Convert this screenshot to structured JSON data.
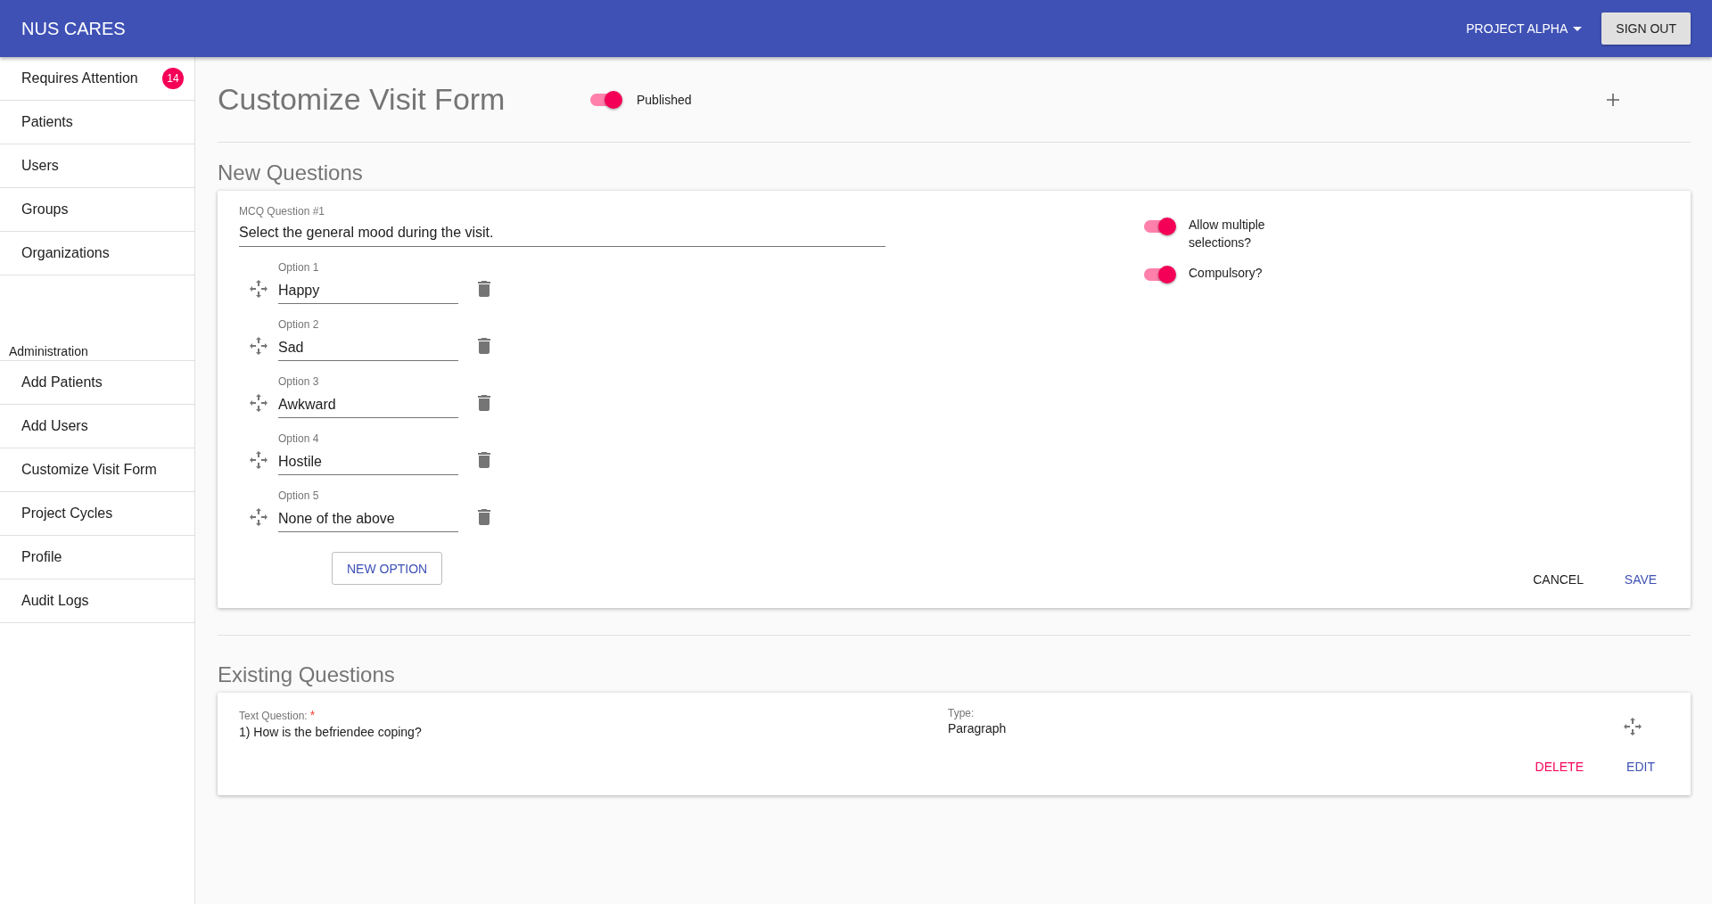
{
  "app_bar": {
    "title": "NUS CARES",
    "project_menu": "PROJECT ALPHA",
    "sign_out": "SIGN OUT"
  },
  "sidebar": {
    "items": [
      {
        "label": "Requires Attention",
        "badge": "14",
        "selected": false
      },
      {
        "label": "Patients",
        "selected": false
      },
      {
        "label": "Users",
        "selected": false
      },
      {
        "label": "Groups",
        "selected": false
      },
      {
        "label": "Organizations",
        "selected": false
      }
    ],
    "section_title": "Administration",
    "admin_items": [
      {
        "label": "Add Patients",
        "selected": false
      },
      {
        "label": "Add Users",
        "selected": false
      },
      {
        "label": "Customize Visit Form",
        "selected": false
      },
      {
        "label": "Project Cycles",
        "selected": false
      },
      {
        "label": "Profile",
        "selected": false
      },
      {
        "label": "Audit Logs",
        "selected": false
      }
    ]
  },
  "page": {
    "title": "Customize Visit Form",
    "published": {
      "label": "Published",
      "on": true
    }
  },
  "new_questions": {
    "heading": "New Questions",
    "question": {
      "label": "MCQ Question #1",
      "value": "Select the general mood during the visit.",
      "options": [
        {
          "label": "Option 1",
          "value": "Happy"
        },
        {
          "label": "Option 2",
          "value": "Sad"
        },
        {
          "label": "Option 3",
          "value": "Awkward"
        },
        {
          "label": "Option 4",
          "value": "Hostile"
        },
        {
          "label": "Option 5",
          "value": "None of the above"
        }
      ],
      "new_option": "NEW OPTION",
      "settings": [
        {
          "label": "Allow multiple selections?",
          "on": true
        },
        {
          "label": "Compulsory?",
          "on": true
        }
      ],
      "cancel": "CANCEL",
      "save": "SAVE"
    }
  },
  "existing_questions": {
    "heading": "Existing Questions",
    "items": [
      {
        "type_label": "Text Question:",
        "required_mark": "*",
        "text": "1) How is the befriendee coping?",
        "type_caption": "Type:",
        "type": "Paragraph",
        "delete": "DELETE",
        "edit": "EDIT"
      }
    ]
  }
}
